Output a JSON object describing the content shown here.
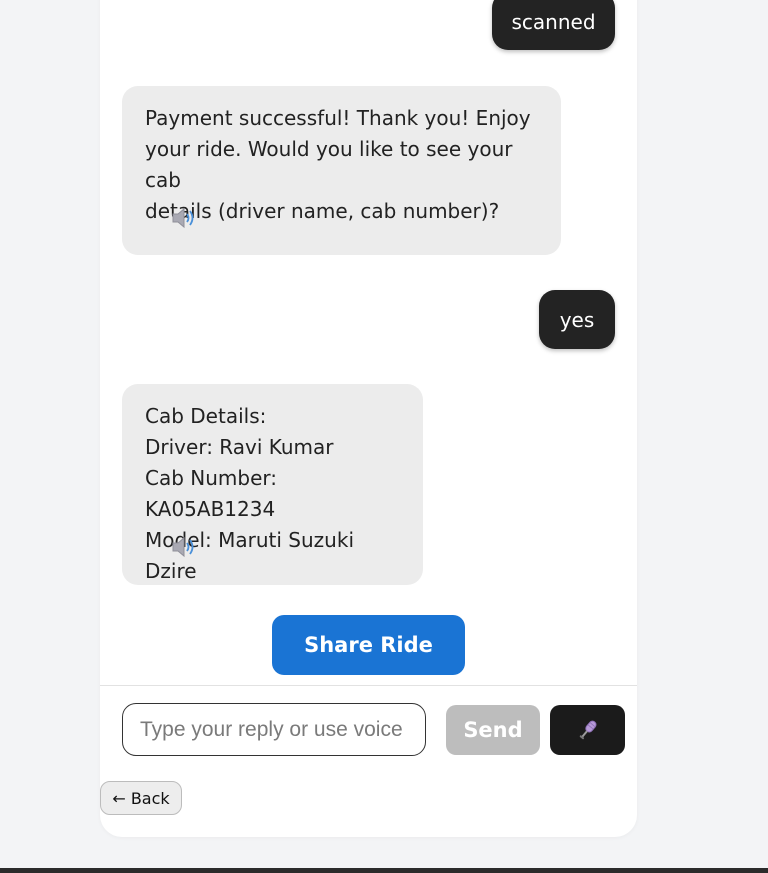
{
  "messages": [
    {
      "role": "user",
      "text": "scanned"
    },
    {
      "role": "bot",
      "lines": [
        "Payment successful! Thank you! Enjoy",
        "your ride. Would you like to see your cab",
        "details (driver name, cab number)?"
      ],
      "icon": "speaker-icon"
    },
    {
      "role": "user",
      "text": "yes"
    },
    {
      "role": "bot",
      "lines": [
        "Cab Details:",
        "Driver: Ravi Kumar",
        "Cab Number: KA05AB1234",
        "Model: Maruti Suzuki Dzire"
      ],
      "icon": "speaker-icon"
    }
  ],
  "actions": {
    "share_ride_label": "Share Ride"
  },
  "composer": {
    "input_value": "",
    "input_placeholder": "Type your reply or use voice",
    "send_label": "Send",
    "mic_icon": "microphone-icon"
  },
  "nav": {
    "back_label": "← Back"
  },
  "colors": {
    "user_bubble": "#232323",
    "bot_bubble": "#ececec",
    "share_button": "#1a74d4",
    "send_disabled": "#bdbdbd",
    "mic_button": "#1b1b1b"
  }
}
